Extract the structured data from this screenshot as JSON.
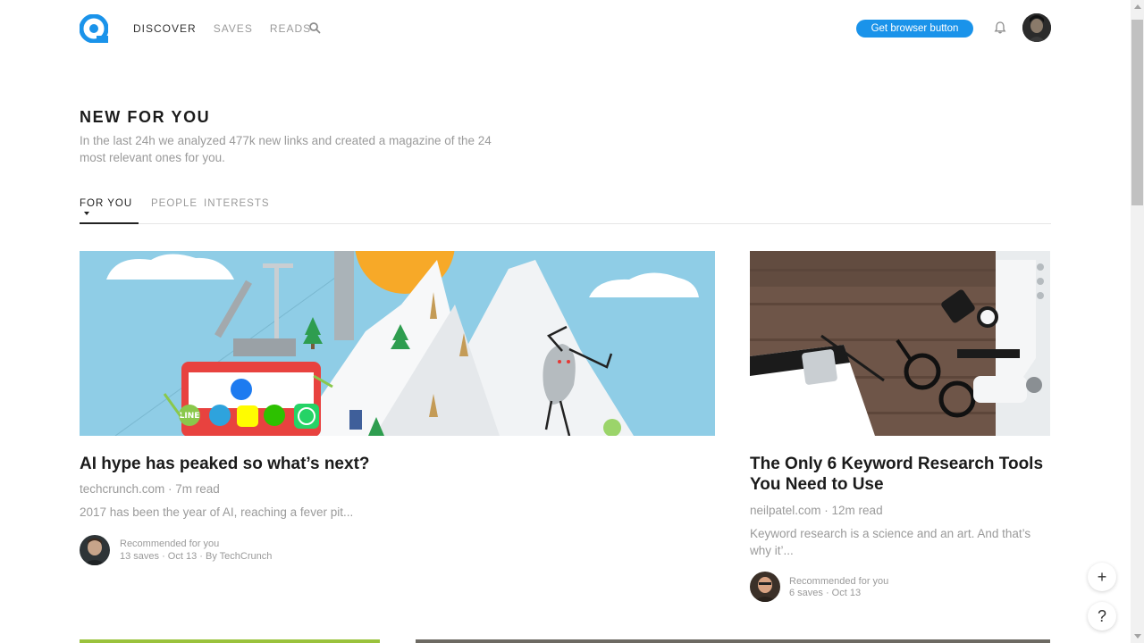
{
  "nav": {
    "items": [
      "DISCOVER",
      "SAVES",
      "READS"
    ],
    "active": "DISCOVER",
    "cta_label": "Get browser button",
    "icons": [
      "logo-icon",
      "search-icon",
      "bell-icon",
      "avatar"
    ]
  },
  "header": {
    "title": "NEW FOR YOU",
    "subtitle": "In the last 24h we analyzed 477k new links and created a magazine of the 24 most relevant ones for you."
  },
  "tabs": {
    "items": [
      "FOR YOU",
      "PEOPLE",
      "INTERESTS"
    ],
    "active": "FOR YOU"
  },
  "cards": [
    {
      "title": "AI hype has peaked so what’s next?",
      "meta": "techcrunch.com · 7m read",
      "excerpt": "2017 has been the year of AI, reaching a fever pit...",
      "rec_line1": "Recommended for you",
      "rec_line2": "13 saves · Oct 13 · By TechCrunch",
      "bind_labels": [
        "LINE"
      ]
    },
    {
      "title": "The Only 6 Keyword Research Tools You Need to Use",
      "meta": "neilpatel.com · 12m read",
      "excerpt": "Keyword research is a science and an art. And that’s why it’...",
      "rec_line1": "Recommended for you",
      "rec_line2": "6 saves · Oct 13"
    }
  ],
  "fabs": {
    "add": "+",
    "help": "?"
  },
  "colors": {
    "accent": "#1a93ea",
    "text_dark": "#1b1b1b",
    "text_muted": "#9a9a9a"
  }
}
